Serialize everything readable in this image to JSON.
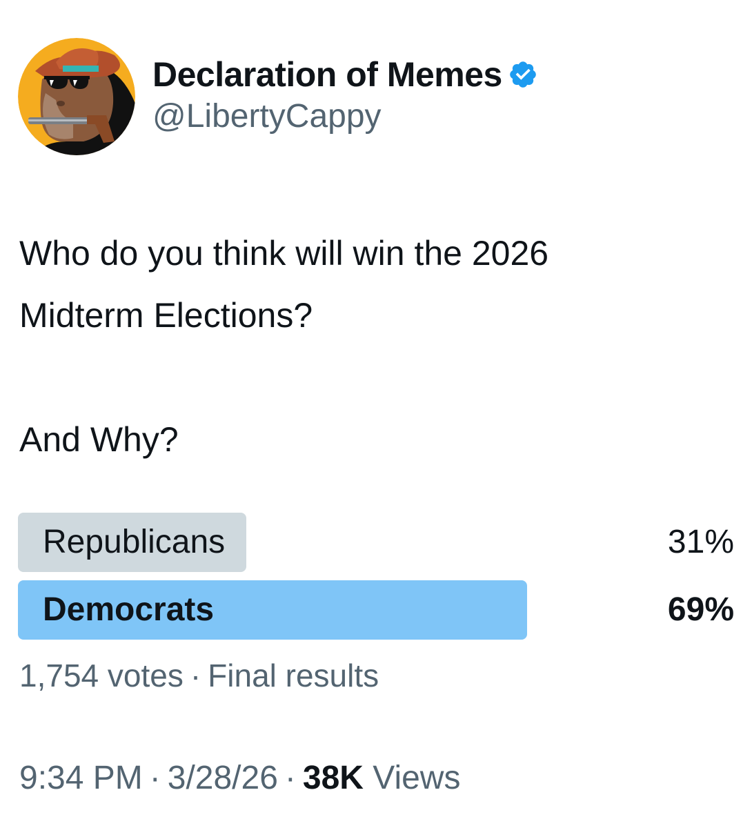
{
  "author": {
    "display_name": "Declaration of Memes",
    "handle": "@LibertyCappy",
    "verified": true,
    "avatar_icon": "capybara-cowboy-avatar",
    "verified_icon": "verified-badge-icon"
  },
  "tweet": {
    "text": "Who do you think will win the 2026\nMidterm Elections?\n\nAnd Why?"
  },
  "poll": {
    "options": [
      {
        "label": "Republicans",
        "percent_label": "31%",
        "fraction": 0.31,
        "winner": false
      },
      {
        "label": "Democrats",
        "percent_label": "69%",
        "fraction": 0.69,
        "winner": true
      }
    ],
    "votes": "1,754 votes",
    "status": "Final results",
    "separator": "·"
  },
  "meta": {
    "time": "9:34 PM",
    "date": "3/28/26",
    "views_count": "38K",
    "views_label": "Views",
    "separator": "·"
  },
  "colors": {
    "text_primary": "#0f1419",
    "text_secondary": "#536471",
    "poll_loser": "#cfd9de",
    "poll_winner": "#7fc5f7",
    "verified_blue": "#1d9bf0",
    "avatar_bg": "#f5ac1f"
  }
}
